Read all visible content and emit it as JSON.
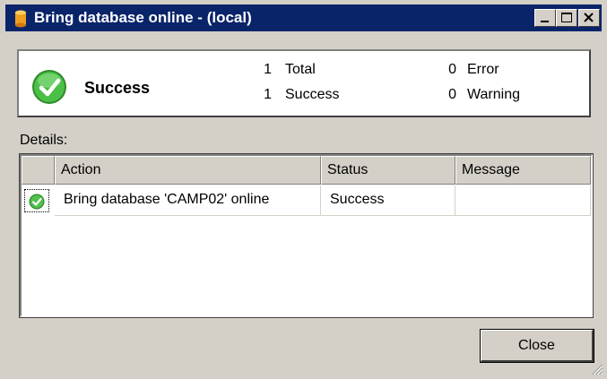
{
  "window": {
    "title": "Bring database online - (local)",
    "title_icon": "database-cylinder-icon",
    "controls": [
      "minimize",
      "maximize",
      "close"
    ]
  },
  "summary": {
    "status_icon": "success-check-icon",
    "status": "Success",
    "total_count": "1",
    "total_label": "Total",
    "success_count": "1",
    "success_label": "Success",
    "error_count": "0",
    "error_label": "Error",
    "warning_count": "0",
    "warning_label": "Warning"
  },
  "details": {
    "label": "Details:",
    "columns": [
      "Action",
      "Status",
      "Message"
    ],
    "rows": [
      {
        "icon": "success-check-icon",
        "action": "Bring database 'CAMP02' online",
        "status": "Success",
        "message": ""
      }
    ]
  },
  "footer": {
    "close_label": "Close"
  },
  "colors": {
    "titlebar": "#0a246a",
    "face": "#d4d0c8",
    "success_green": "#3fa63a"
  }
}
